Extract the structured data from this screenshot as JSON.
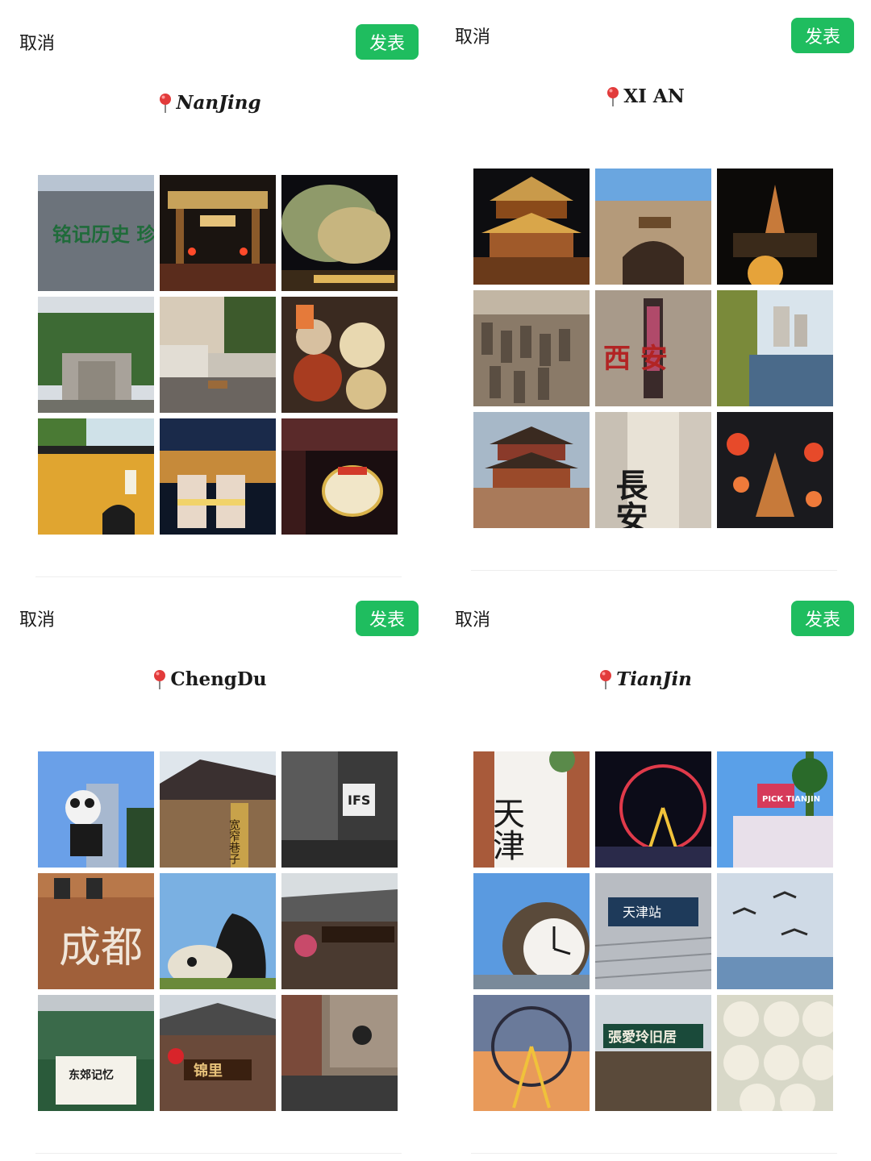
{
  "panels": [
    {
      "id": "nanjing",
      "cancel_label": "取消",
      "publish_label": "发表",
      "city_title": "NanJing",
      "photos": [
        {
          "name": "memorial-wall-photo",
          "text": "铭记历史 珍爱和平"
        },
        {
          "name": "paifang-gate-night-photo"
        },
        {
          "name": "blossom-tree-night-photo"
        },
        {
          "name": "memorial-monument-photo"
        },
        {
          "name": "river-canal-dusk-photo"
        },
        {
          "name": "local-food-table-photo"
        },
        {
          "name": "yellow-temple-wall-photo"
        },
        {
          "name": "drinks-qinhuai-night-photo"
        },
        {
          "name": "lantern-street-night-photo"
        }
      ]
    },
    {
      "id": "xian",
      "cancel_label": "取消",
      "publish_label": "发表",
      "city_title": "XI AN",
      "photos": [
        {
          "name": "bell-tower-night-photo"
        },
        {
          "name": "city-wall-gate-photo"
        },
        {
          "name": "pagoda-night-photo"
        },
        {
          "name": "terracotta-warriors-photo"
        },
        {
          "name": "xian-sign-wall-photo",
          "text": "西 安"
        },
        {
          "name": "river-moat-photo"
        },
        {
          "name": "drum-tower-sunset-photo"
        },
        {
          "name": "changan-sign-photo",
          "text": "長安"
        },
        {
          "name": "lantern-pagoda-photo"
        }
      ]
    },
    {
      "id": "chengdu",
      "cancel_label": "取消",
      "publish_label": "发表",
      "city_title": "ChengDu",
      "photos": [
        {
          "name": "panda-climbing-building-photo"
        },
        {
          "name": "kuanzhai-alley-photo",
          "text": "宽窄巷子"
        },
        {
          "name": "ifs-mall-photo",
          "text": "IFS"
        },
        {
          "name": "chengdu-brick-wall-photo",
          "text": "成都"
        },
        {
          "name": "panda-sculpture-photo"
        },
        {
          "name": "traditional-roof-photo"
        },
        {
          "name": "green-train-photo",
          "text": "东郊记忆"
        },
        {
          "name": "jinli-gate-photo",
          "text": "锦里"
        },
        {
          "name": "street-shops-photo"
        }
      ]
    },
    {
      "id": "tianjin",
      "cancel_label": "取消",
      "publish_label": "发表",
      "city_title": "TianJin",
      "photos": [
        {
          "name": "tianjin-banner-photo",
          "text": "天津"
        },
        {
          "name": "ferris-wheel-night-photo"
        },
        {
          "name": "pick-tianjin-sign-photo",
          "text": "PICK TIANJIN"
        },
        {
          "name": "clock-sculpture-photo"
        },
        {
          "name": "tianjin-station-sign-photo",
          "text": "天津站"
        },
        {
          "name": "seagulls-sea-photo"
        },
        {
          "name": "ferris-wheel-sunset-photo"
        },
        {
          "name": "zhang-ailing-residence-photo",
          "text": "張愛玲旧居"
        },
        {
          "name": "baozi-buns-photo"
        }
      ]
    }
  ]
}
